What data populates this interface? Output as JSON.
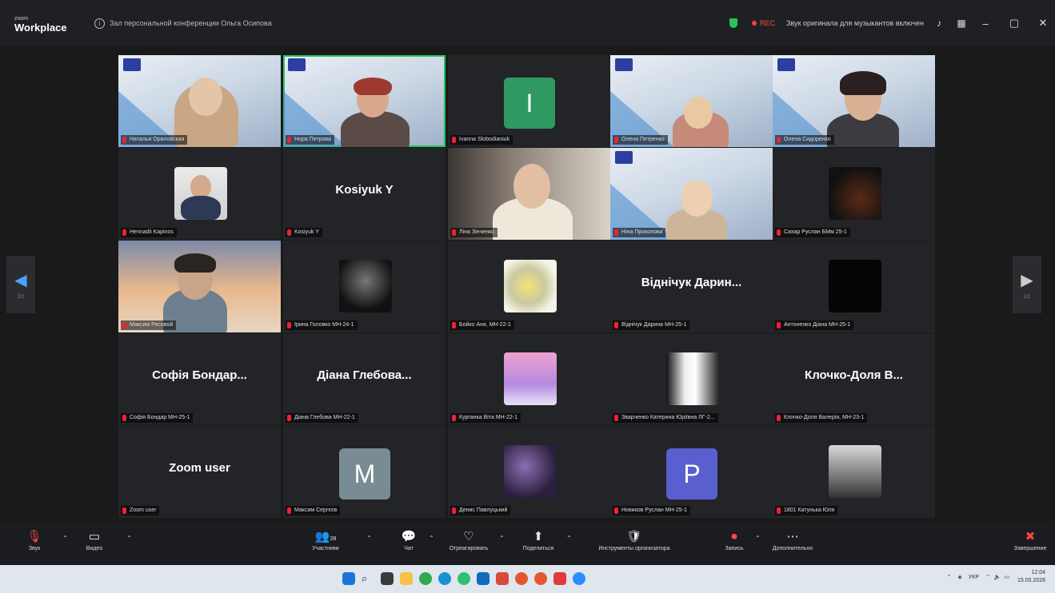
{
  "titlebar": {
    "logo_small": "zoom",
    "logo": "Workplace",
    "meeting_info": "Зал персональной конференции Ольга Осипова",
    "rec": "REC",
    "audio_notice": "Звук оригинала для музыкантов включен"
  },
  "tiles": [
    {
      "label": "Наталья Оряловская",
      "kind": "video"
    },
    {
      "label": "Нора Петрова",
      "kind": "video",
      "active": true
    },
    {
      "label": "Ivanna Slobodianiuk",
      "kind": "avatar",
      "avatar_letter": "I",
      "avatar_color": "#2e9a62"
    },
    {
      "label": "Олена Петренко",
      "kind": "video"
    },
    {
      "label": "Олена Сидоренко",
      "kind": "video"
    },
    {
      "label": "Hennadii Kapinos",
      "kind": "photo"
    },
    {
      "label": "Kosiyuk Y",
      "kind": "name",
      "name": "Kosiyuk Y"
    },
    {
      "label": "Ліна Зінченко",
      "kind": "video_room"
    },
    {
      "label": "Ніна Прокопова",
      "kind": "video"
    },
    {
      "label": "Сахар Руслан БМм 25-1",
      "kind": "dark_photo"
    },
    {
      "label": "Максим Рясовой",
      "kind": "video_sunset"
    },
    {
      "label": "Ірина Головко МН-24-1",
      "kind": "photo_dark"
    },
    {
      "label": "Бойко Аня, МН-22-1",
      "kind": "photo_flowers"
    },
    {
      "label": "Віднічук Дарина МН-25-1",
      "kind": "name",
      "name": "Віднічук Дарин..."
    },
    {
      "label": "Антоненко Діана МН-25-1",
      "kind": "black_square"
    },
    {
      "label": "Софія Бондар МН-25-1",
      "kind": "name",
      "name": "Софія Бондар..."
    },
    {
      "label": "Діана Глебова МН-22-1",
      "kind": "name",
      "name": "Діана Глебова..."
    },
    {
      "label": "Курганка Віта МН-22-1",
      "kind": "photo_pink"
    },
    {
      "label": "Зварченко Катерина Юріївна ЛГ-2...",
      "kind": "photo_anime"
    },
    {
      "label": "Клочко-Доля Валерія, МН-23-1",
      "kind": "name",
      "name": "Клочко-Доля В..."
    },
    {
      "label": "Zoom user",
      "kind": "name",
      "name": "Zoom user"
    },
    {
      "label": "Максим Сергєєв",
      "kind": "avatar",
      "avatar_letter": "M",
      "avatar_color": "#7a8c93"
    },
    {
      "label": "Денис Павлуцький",
      "kind": "photo_purple"
    },
    {
      "label": "Новиков Руслан МН-25-1",
      "kind": "avatar",
      "avatar_letter": "P",
      "avatar_color": "#5a5fcf"
    },
    {
      "label": "1801 Катунька Юля",
      "kind": "photo_gray"
    }
  ],
  "nav": {
    "left_page": "2/2",
    "right_page": "2/2",
    "left_arrow": "◀",
    "right_arrow": "▶"
  },
  "controls": {
    "audio": "Звук",
    "video": "Видео",
    "participants": "Участники",
    "participants_count": "28",
    "chat": "Чат",
    "reactions": "Отреагировать",
    "share": "Поделиться",
    "host_tools": "Инструменты организатора",
    "record": "Запись",
    "more": "Дополнительно",
    "end": "Завершение"
  },
  "tray": {
    "lang": "УКР",
    "time": "12:04",
    "date": "15.05.2026"
  },
  "colors": {
    "active_speaker": "#22c55e",
    "nav_arrow": "#4aa3ff",
    "rec": "#ff3b3b"
  }
}
